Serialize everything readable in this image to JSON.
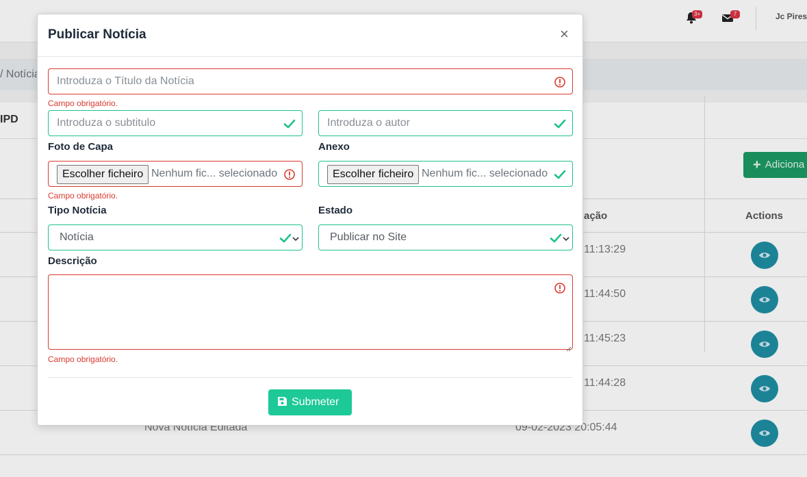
{
  "background": {
    "header": {
      "notifications_badge": "3+",
      "messages_badge": "7",
      "user_name": "Jc Pires"
    },
    "breadcrumb": "/ Notícia",
    "card_title": "IPD",
    "add_button_label": "Adiciona",
    "table": {
      "date_header": "ação",
      "actions_header": "Actions",
      "rows": [
        {
          "time": "11:13:29"
        },
        {
          "time": "11:44:50"
        },
        {
          "time": "11:45:23"
        },
        {
          "time": "11:44:28"
        },
        {
          "title": "Nova Notícia Editada",
          "full_date": "09-02-2023 20:05:44"
        }
      ]
    }
  },
  "modal": {
    "title": "Publicar Notícia",
    "close_symbol": "×",
    "title_field": {
      "placeholder": "Introduza o Título da Notícia",
      "error": "Campo obrigatório."
    },
    "subtitle_field": {
      "placeholder": "Introduza o subtitulo"
    },
    "author_field": {
      "placeholder": "Introduza o autor"
    },
    "cover_photo": {
      "label": "Foto de Capa",
      "button": "Escolher ficheiro",
      "file_text": "Nenhum fic... selecionado",
      "error": "Campo obrigatório."
    },
    "attachment": {
      "label": "Anexo",
      "button": "Escolher ficheiro",
      "file_text": "Nenhum fic... selecionado"
    },
    "news_type": {
      "label": "Tipo Notícia",
      "value": "Notícia"
    },
    "status": {
      "label": "Estado",
      "value": "Publicar no Site"
    },
    "description": {
      "label": "Descrição",
      "value": "",
      "error": "Campo obrigatório."
    },
    "submit_label": "Submeter"
  },
  "colors": {
    "valid": "#1fc08e",
    "invalid": "#d93a2e",
    "submit": "#1dc997",
    "add_button": "#1c9963",
    "eye_button": "#1f8fa3"
  },
  "icons": [
    "bell-icon",
    "envelope-icon",
    "plus-icon",
    "eye-icon",
    "close-icon",
    "error-icon",
    "check-icon",
    "chevron-down-icon",
    "save-icon"
  ]
}
